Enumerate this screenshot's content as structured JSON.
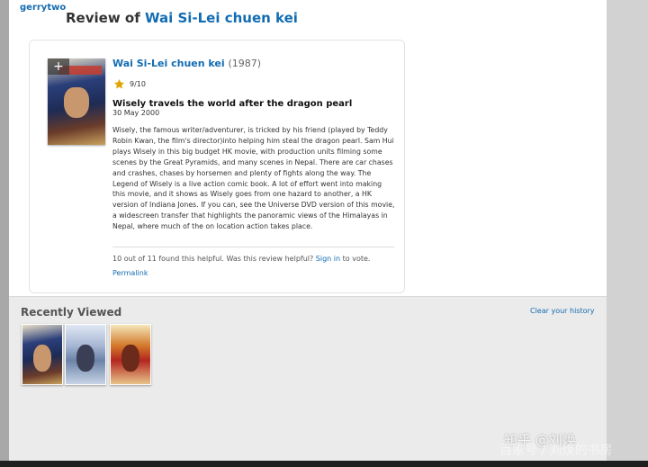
{
  "header": {
    "username": "gerrytwo",
    "title_prefix": "Review of ",
    "title_movie": "Wai Si-Lei chuen kei"
  },
  "review": {
    "movie_title": "Wai Si-Lei chuen kei",
    "year": "(1987)",
    "rating_text": "9/10",
    "rating_value": 9,
    "rating_max": 10,
    "summary": "Wisely travels the world after the dragon pearl",
    "date": "30 May 2000",
    "body": "Wisely, the famous writer/adventurer, is tricked by his friend (played by Teddy Robin Kwan, the film's director)into helping him steal the dragon pearl. Sam Hui plays Wisely in this big budget HK movie, with production units filming some scenes by the Great Pyramids, and many scenes in Nepal. There are car chases and crashes, chases by horsemen and plenty of fights along the way. The Legend of Wisely is a live action comic book. A lot of effort went into making this movie, and it shows as Wisely goes from one hazard to another, a HK version of Indiana Jones. If you can, see the Universe DVD version of this movie, a widescreen transfer that highlights the panoramic views of the Himalayas in Nepal, where much of the on location action takes place.",
    "helpful_text": "10 out of 11 found this helpful. Was this review helpful? ",
    "sign_in": "Sign in",
    "helpful_suffix": " to vote.",
    "permalink": "Permalink",
    "poster_add": "+"
  },
  "recently_viewed": {
    "title": "Recently Viewed",
    "clear": "Clear your history",
    "thumbnails": [
      "poster-wai-si-lei",
      "poster-second-movie",
      "poster-kung-fu-master"
    ]
  },
  "watermark": {
    "line1": "知乎 @刘焕",
    "line2": "百家号 / 刘焕的书房"
  },
  "colors": {
    "link": "#136cb2",
    "star": "#e0a500"
  },
  "icons": {
    "rating": "star-icon",
    "add": "plus-icon"
  }
}
